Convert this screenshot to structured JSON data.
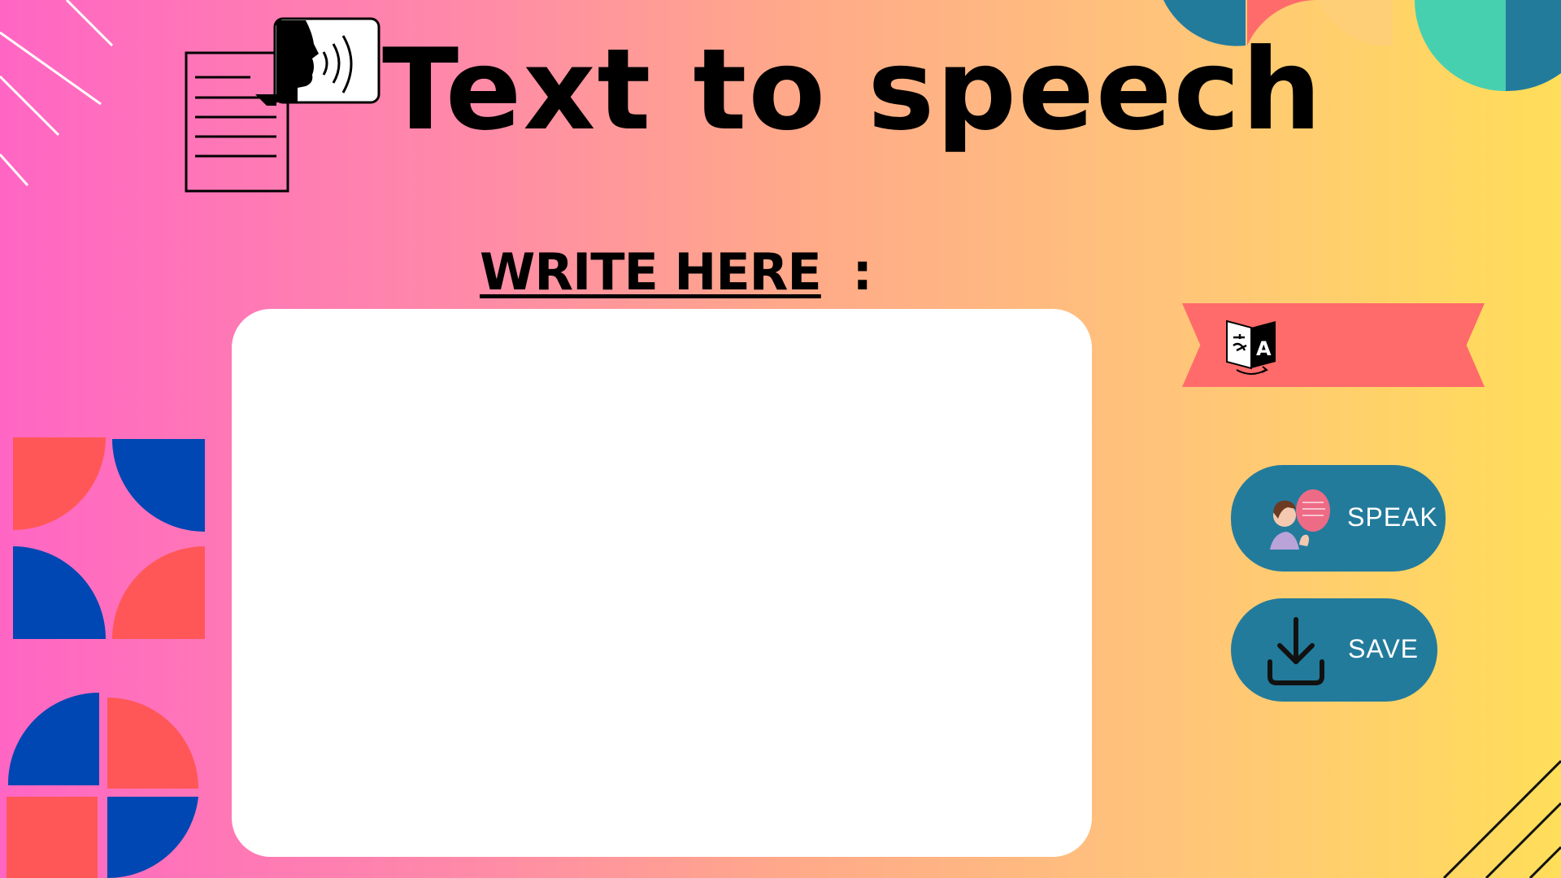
{
  "header": {
    "title": "Text to speech"
  },
  "editor": {
    "label": "WRITE HERE",
    "label_suffix": ":",
    "value": "",
    "placeholder": ""
  },
  "actions": {
    "speak_label": "SPEAK",
    "save_label": "SAVE"
  },
  "icons": {
    "header": "document-speaking-head-icon",
    "translate": "translate-icon",
    "speak": "person-speech-bubble-icon",
    "save": "download-icon"
  },
  "colors": {
    "gradient_left": "#ff66c4",
    "gradient_right": "#ffde59",
    "button": "#237b9c",
    "ribbon": "#ff6b6b",
    "shape_blue": "#0047b3",
    "shape_coral": "#ff5757",
    "shape_teal": "#46d0b0",
    "shape_steel": "#237b9c"
  }
}
